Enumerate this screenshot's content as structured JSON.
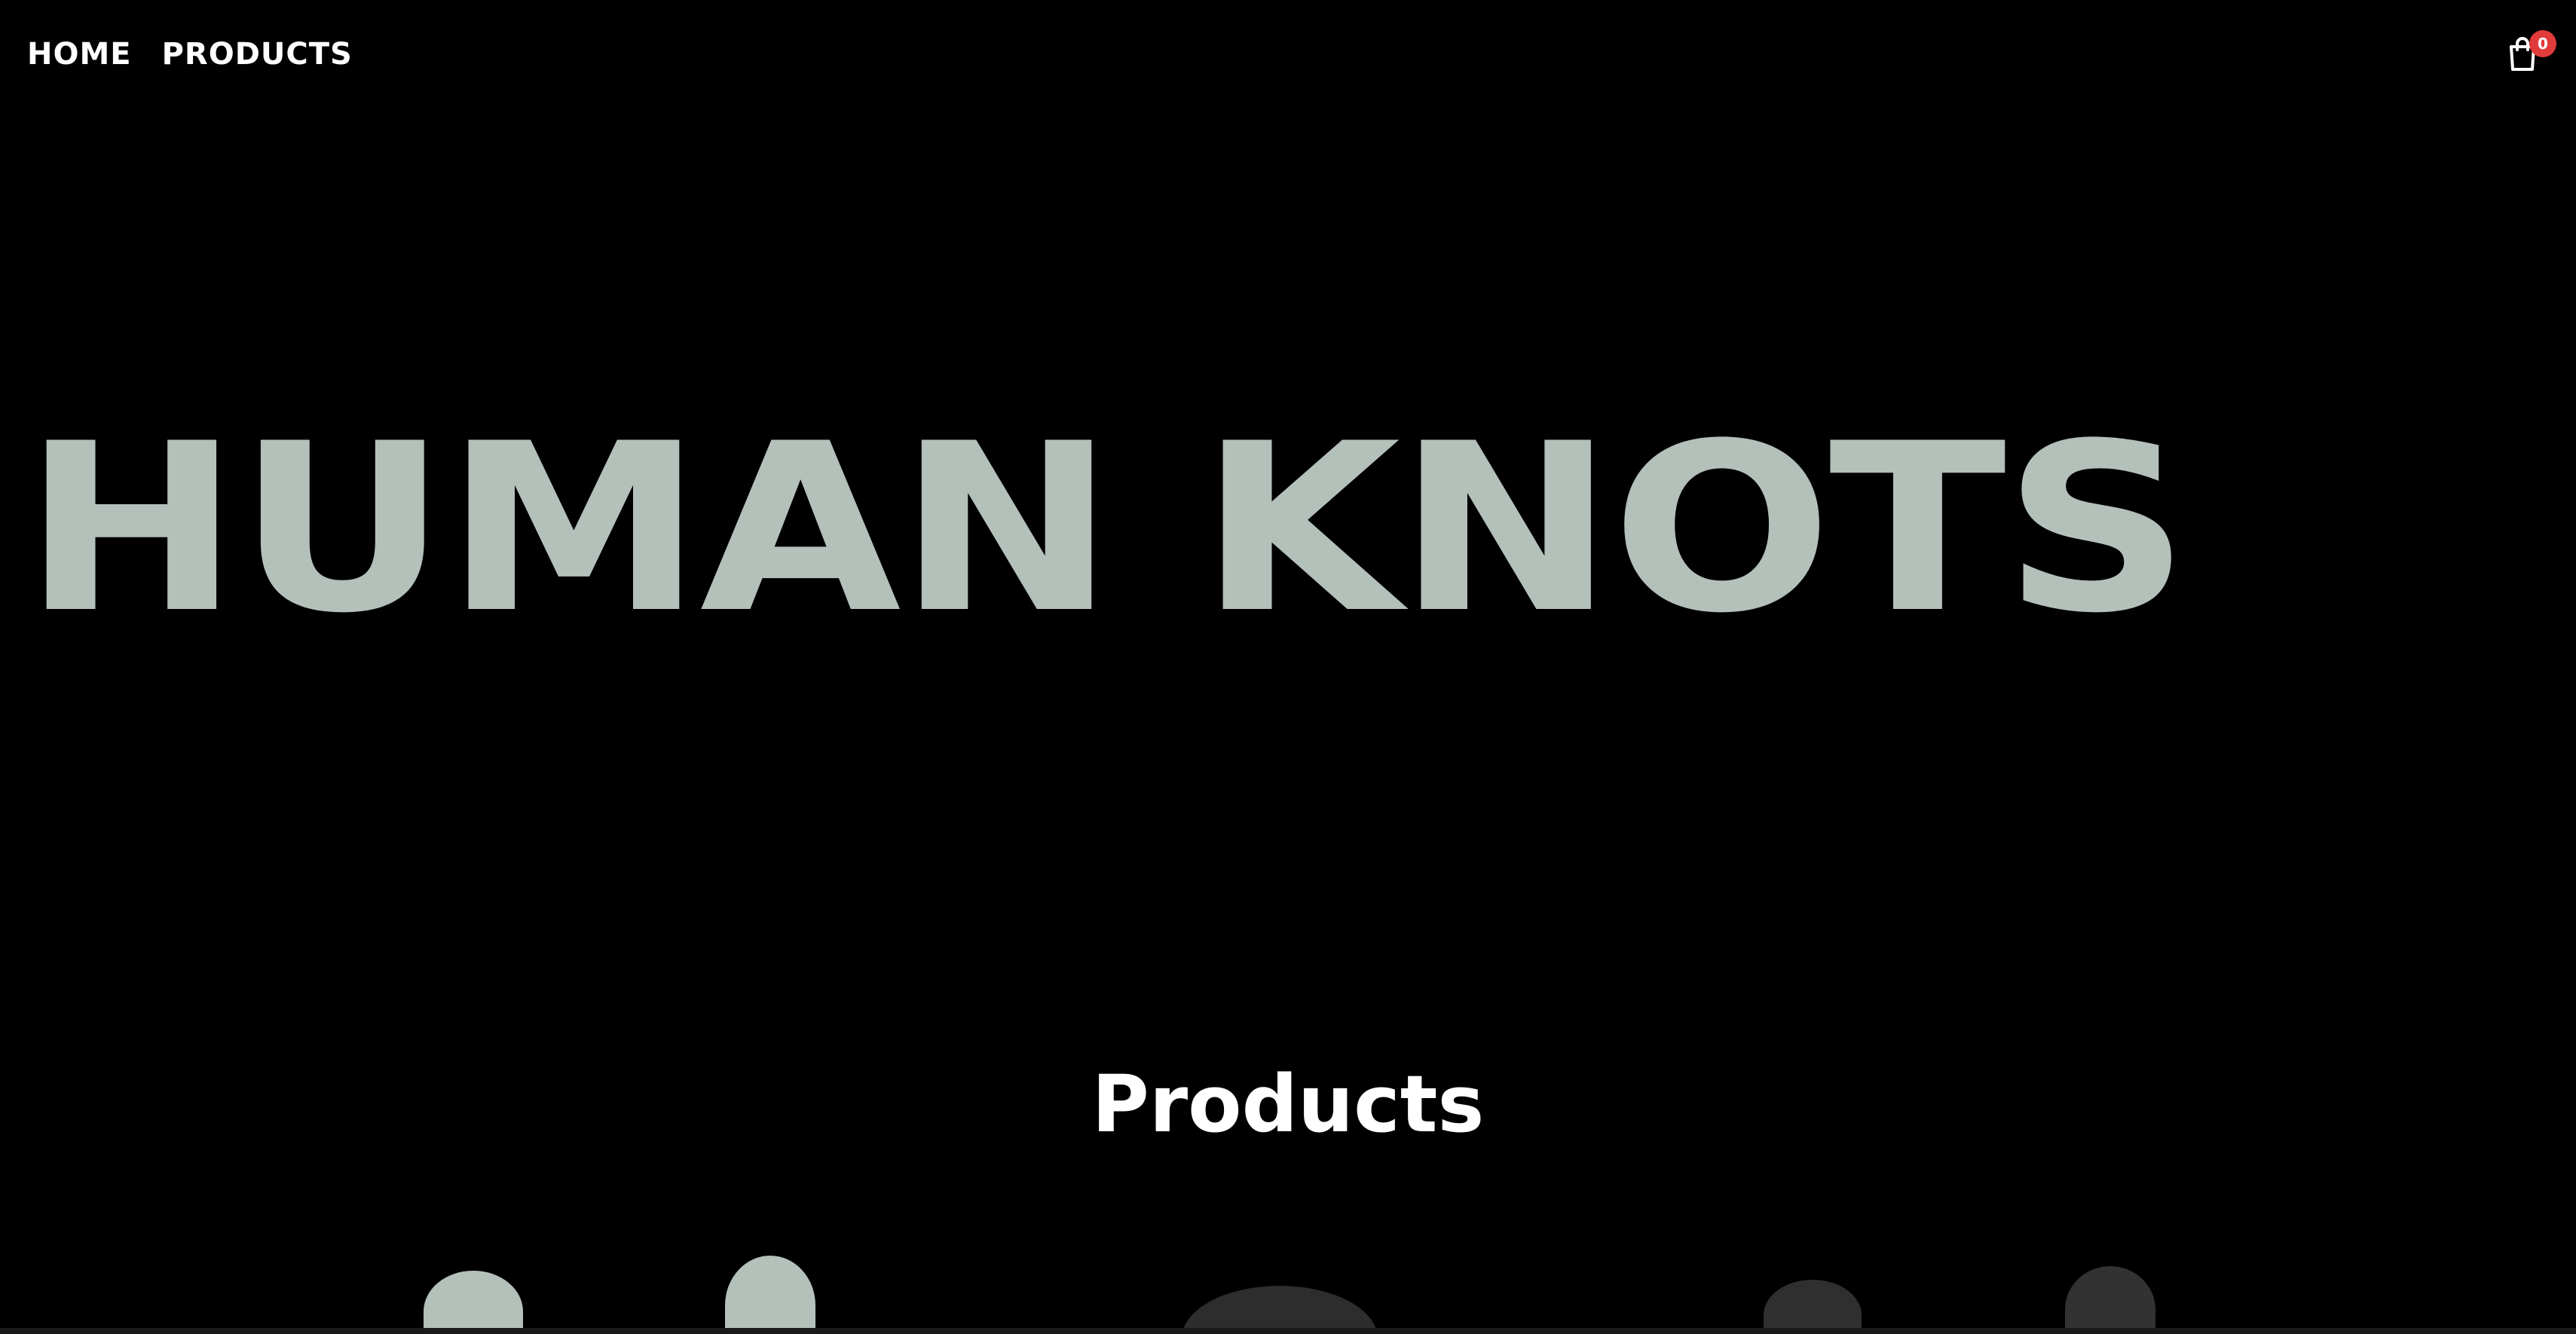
{
  "nav": {
    "links": [
      {
        "label": "HOME"
      },
      {
        "label": "PRODUCTS"
      }
    ]
  },
  "cart": {
    "icon": "shopping-bag-icon",
    "count": "0",
    "badge_color": "#e23b3b"
  },
  "hero": {
    "title": "HUMAN KNOTS",
    "color": "#b4c0ba"
  },
  "products_section": {
    "title": "Products"
  },
  "colors": {
    "background": "#000000",
    "text": "#ffffff",
    "accent": "#b4c0ba"
  }
}
